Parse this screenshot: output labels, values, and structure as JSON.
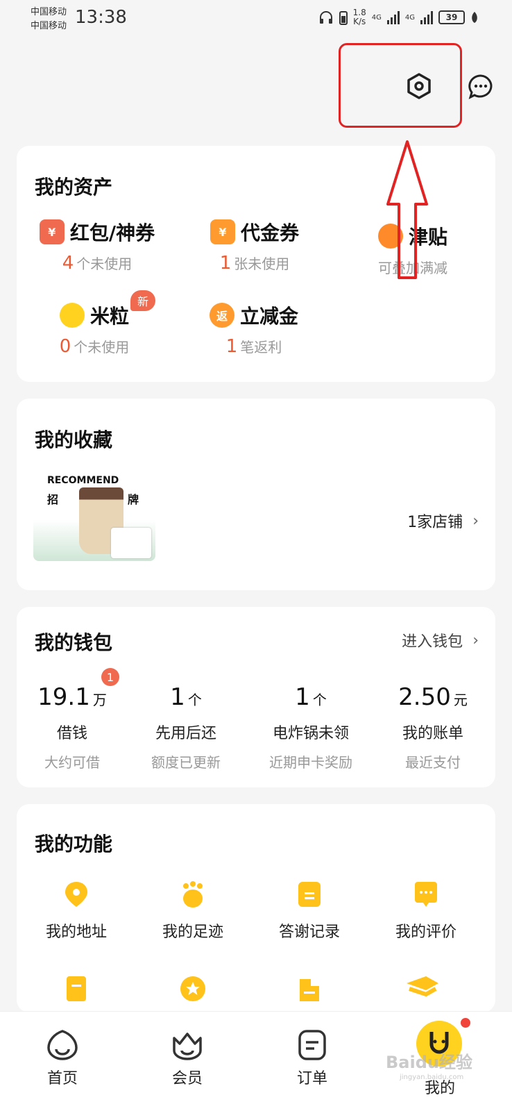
{
  "status": {
    "carrier1": "中国移动",
    "carrier2": "中国移动",
    "time": "13:38",
    "speed_value": "1.8",
    "speed_unit": "K/s",
    "net1": "4G",
    "net2": "4G",
    "battery": "39"
  },
  "assets": {
    "title": "我的资产",
    "items": [
      {
        "name": "红包/神券",
        "count": "4",
        "unit": "个未使用",
        "icon": "red-packet-icon",
        "color": "#f06a4f"
      },
      {
        "name": "代金券",
        "count": "1",
        "unit": "张未使用",
        "icon": "voucher-icon",
        "color": "#ff9a2e"
      },
      {
        "name": "津贴",
        "count": "",
        "unit": "可叠加满减",
        "icon": "allowance-icon",
        "color": "#ff8a2a"
      },
      {
        "name": "米粒",
        "count": "0",
        "unit": "个未使用",
        "icon": "rice-icon",
        "color": "#ffd21f",
        "badge": "新"
      },
      {
        "name": "立减金",
        "count": "1",
        "unit": "笔返利",
        "icon": "rebate-icon",
        "color": "#ff9a2e",
        "glyph": "返"
      }
    ]
  },
  "favorites": {
    "title": "我的收藏",
    "image_title": "RECOMMEND",
    "image_left": "招",
    "image_right": "牌",
    "shop_count": "1家店铺"
  },
  "wallet": {
    "title": "我的钱包",
    "enter": "进入钱包",
    "badge": "1",
    "items": [
      {
        "num": "19.1",
        "unit": "万",
        "label": "借钱",
        "hint": "大约可借"
      },
      {
        "num": "1",
        "unit": "个",
        "label": "先用后还",
        "hint": "额度已更新"
      },
      {
        "num": "1",
        "unit": "个",
        "label": "电炸锅未领",
        "hint": "近期申卡奖励"
      },
      {
        "num": "2.50",
        "unit": "元",
        "label": "我的账单",
        "hint": "最近支付"
      }
    ]
  },
  "functions": {
    "title": "我的功能",
    "items": [
      {
        "label": "我的地址",
        "icon": "location-icon"
      },
      {
        "label": "我的足迹",
        "icon": "paw-icon"
      },
      {
        "label": "答谢记录",
        "icon": "document-icon"
      },
      {
        "label": "我的评价",
        "icon": "comment-icon"
      }
    ]
  },
  "tabs": [
    {
      "label": "首页",
      "icon": "home-face-icon"
    },
    {
      "label": "会员",
      "icon": "crown-face-icon"
    },
    {
      "label": "订单",
      "icon": "order-icon"
    },
    {
      "label": "我的",
      "icon": "mine-icon"
    }
  ],
  "watermark": {
    "text": "Baidu经验",
    "url": "jingyan.baidu.com"
  },
  "colors": {
    "accent": "#ffc21a",
    "highlight": "#e12323",
    "orange": "#ec5a33"
  }
}
